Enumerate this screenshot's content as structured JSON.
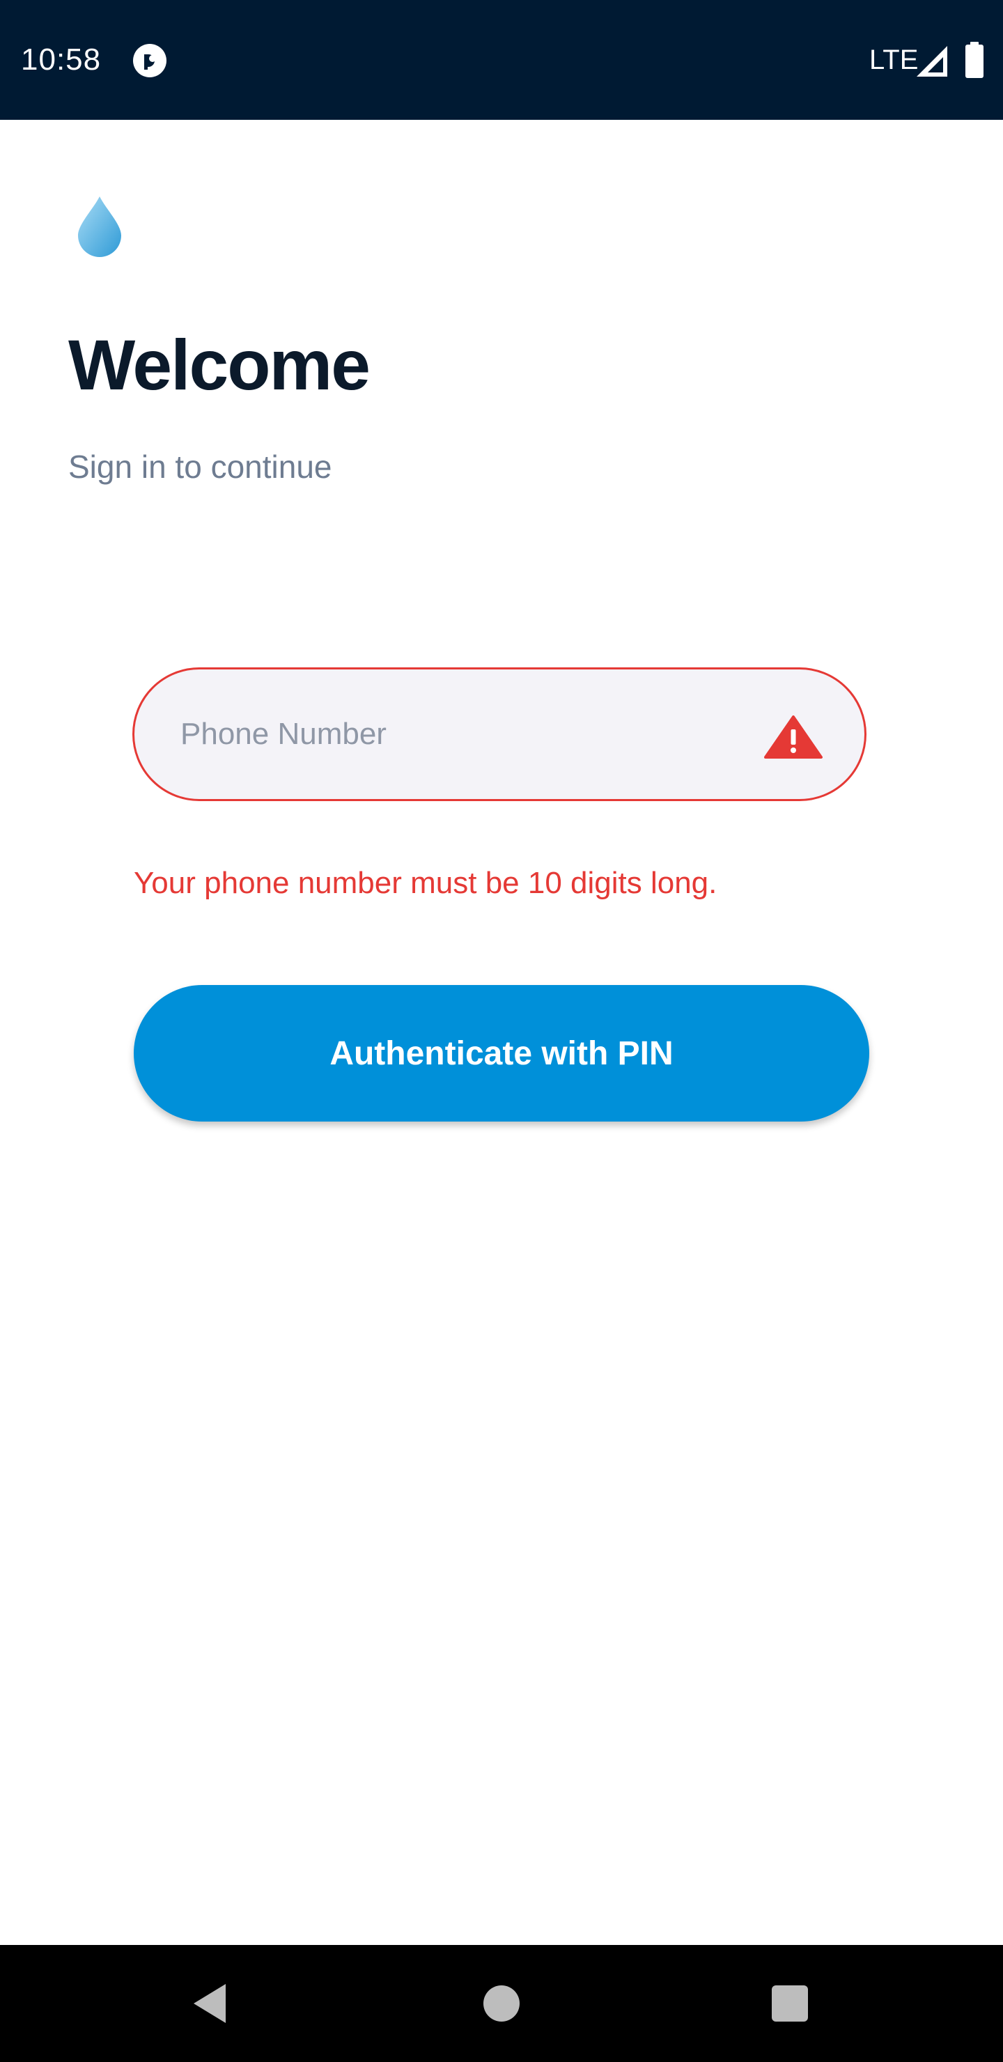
{
  "status_bar": {
    "time": "10:58",
    "network": "LTE",
    "app_icon": "pocket-casts-icon",
    "signal_icon": "signal-icon",
    "battery_icon": "battery-icon"
  },
  "header": {
    "logo_icon": "water-drop-icon",
    "title": "Welcome",
    "subtitle": "Sign in to continue"
  },
  "form": {
    "phone_placeholder": "Phone Number",
    "phone_value": "",
    "error_icon": "warning-icon",
    "error_message": "Your phone number must be 10 digits long.",
    "submit_label": "Authenticate with PIN"
  },
  "nav_bar": {
    "back_icon": "back-triangle-icon",
    "home_icon": "home-circle-icon",
    "recents_icon": "recents-square-icon"
  },
  "colors": {
    "status_bar": "#001a33",
    "title": "#0b1a2b",
    "subtitle": "#6e7c91",
    "error": "#e53935",
    "field_background": "#f4f3f8",
    "button": "#0090d9",
    "button_text": "#ffffff"
  }
}
